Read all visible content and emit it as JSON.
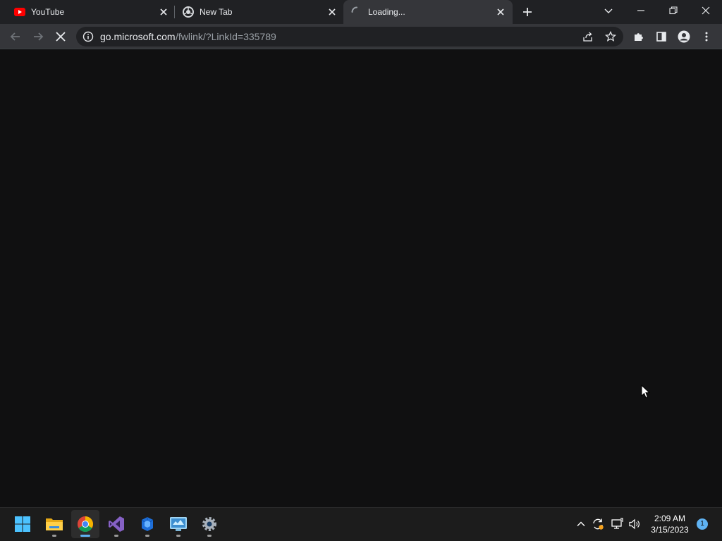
{
  "tabs": [
    {
      "title": "YouTube",
      "icon": "youtube-icon"
    },
    {
      "title": "New Tab",
      "icon": "chrome-icon"
    },
    {
      "title": "Loading...",
      "icon": "loading-spinner-icon",
      "active": true
    }
  ],
  "toolbar": {
    "url_host": "go.microsoft.com",
    "url_path": "/fwlink/?LinkId=335789"
  },
  "taskbar": {
    "apps": [
      "start-icon",
      "file-explorer-icon",
      "chrome-icon",
      "visual-studio-icon",
      "azure-data-studio-icon",
      "control-panel-icon",
      "settings-icon"
    ],
    "time": "2:09 AM",
    "date": "3/15/2023",
    "notification_count": "1"
  },
  "colors": {
    "tab_strip": "#202124",
    "toolbar": "#35363a",
    "content": "#101011",
    "taskbar": "#1c1c1c",
    "accent": "#5fb2f2"
  }
}
